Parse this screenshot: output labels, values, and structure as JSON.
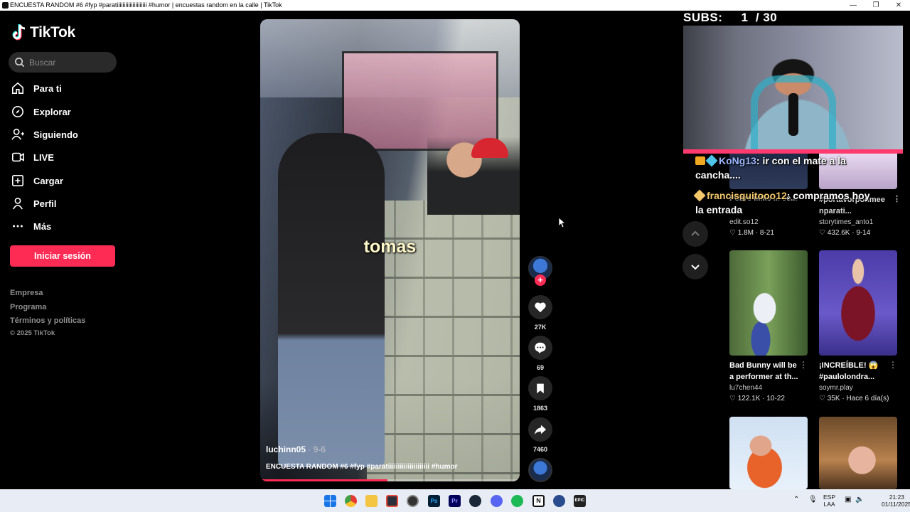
{
  "window": {
    "title": "ENCUESTA RANDOM #6 #fyp #paratiiiiiiiiiiiiiiiiiiiii #humor | encuestas random en la calle | TikTok"
  },
  "sidebar": {
    "logo": "TikTok",
    "search_placeholder": "Buscar",
    "nav": [
      {
        "label": "Para ti",
        "icon": "home-icon"
      },
      {
        "label": "Explorar",
        "icon": "compass-icon"
      },
      {
        "label": "Siguiendo",
        "icon": "following-icon"
      },
      {
        "label": "LIVE",
        "icon": "live-icon"
      },
      {
        "label": "Cargar",
        "icon": "upload-icon"
      },
      {
        "label": "Perfil",
        "icon": "profile-icon"
      },
      {
        "label": "Más",
        "icon": "more-icon"
      }
    ],
    "login_label": "Iniciar sesión",
    "footer_links": [
      "Empresa",
      "Programa",
      "Términos y políticas"
    ],
    "copyright": "© 2025 TikTok"
  },
  "video": {
    "caption": "tomas",
    "author": "luchinn05",
    "date": " · 9-6",
    "description": "ENCUESTA RANDOM #6 #fyp #paratiiiiiiiiiiiiiiiiiiiii #humor",
    "progress": 0.49
  },
  "actions": {
    "likes": "27K",
    "comments": "69",
    "saves": "1863",
    "shares": "7460"
  },
  "stream_overlay": {
    "subs_label": "SUBS:     1  / 30",
    "chat": [
      {
        "user": "KoNg13",
        "message": ": ir con el mate a la cancha...."
      },
      {
        "user": "francisquitooo12",
        "message": ": compramos hoy la entrada"
      }
    ],
    "accent_color": "#ff3a6e"
  },
  "partial_cards": [
    {
      "title": "Pobre Mike ... se...",
      "user": "edit.so12",
      "stats": "♡ 1.8M · 8-21"
    },
    {
      "title": "#portavorponmee nparati...",
      "user": "storytimes_anto1",
      "stats": "♡ 432.6K · 9-14"
    }
  ],
  "cards": [
    {
      "title": "Bad Bunny will be",
      "title2": "a performer at th...",
      "user": "lu7chen44",
      "stats": "♡ 122.1K · 10-22"
    },
    {
      "title": "¡INCREÍBLE! 😱",
      "title2": "#paulolondra...",
      "user": "soymr.play",
      "stats": "♡ 35K · Hace 6 día(s)"
    }
  ],
  "taskbar": {
    "lang": "ESP",
    "lang2": "LAA",
    "time": "21:23",
    "date": "01/11/2025"
  },
  "colors": {
    "brand": "#fe2c55",
    "background": "#000000"
  }
}
